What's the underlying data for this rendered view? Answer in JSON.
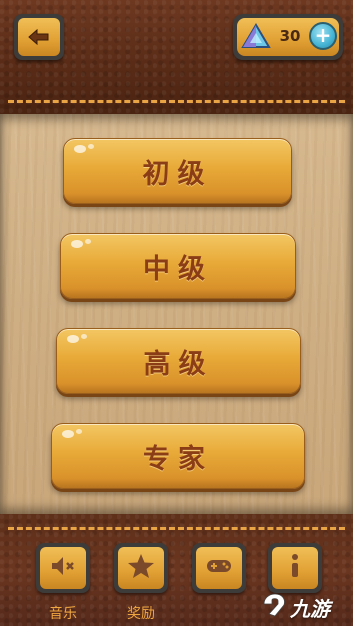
{
  "header": {
    "back_button_icon": "back-arrow-icon",
    "gem_icon": "crystal-gem-icon",
    "gem_count": "30",
    "add_icon": "plus-icon"
  },
  "levels": [
    {
      "label": "初级"
    },
    {
      "label": "中级"
    },
    {
      "label": "高级"
    },
    {
      "label": "专家"
    }
  ],
  "bottom_bar": [
    {
      "icon": "sound-muted-icon",
      "label": "音乐"
    },
    {
      "icon": "star-icon",
      "label": "奖励"
    },
    {
      "icon": "game-controller-icon",
      "label": ""
    },
    {
      "icon": "info-icon",
      "label": ""
    }
  ],
  "watermark": {
    "text": "九游"
  },
  "colors": {
    "leather": "#5a2d18",
    "stitch": "#e9a545",
    "wood": "#d0b084",
    "button_gold": "#e8aa38",
    "button_text": "#8b3e16"
  }
}
